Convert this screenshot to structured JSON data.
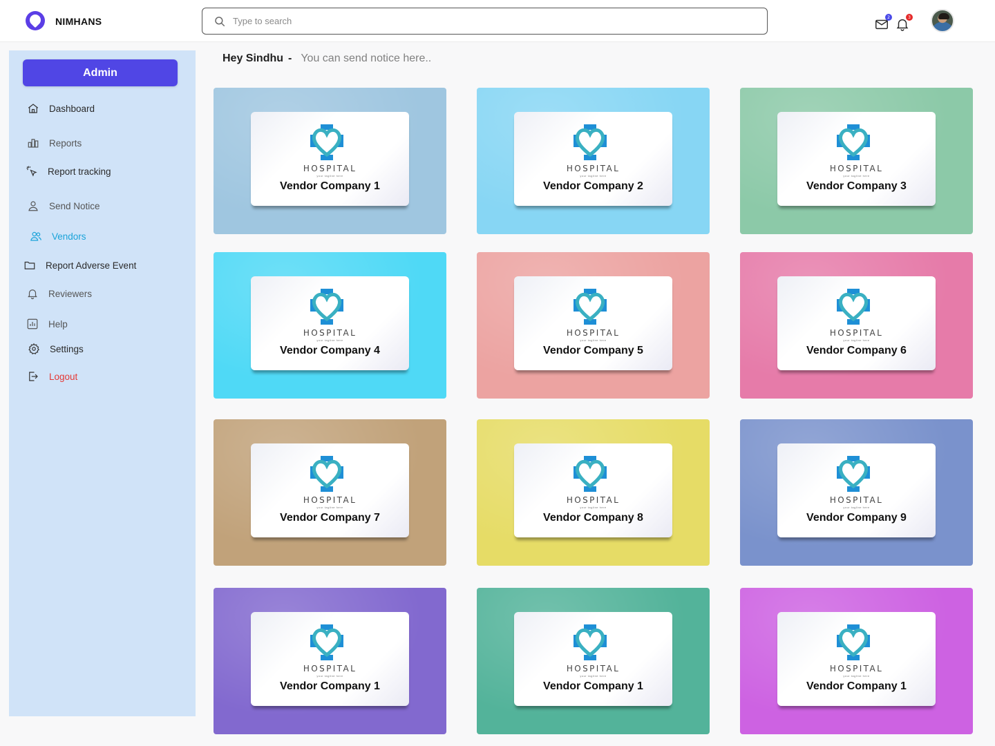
{
  "header": {
    "brand": "NIMHANS",
    "search_placeholder": "Type to search",
    "mail_badge": "2",
    "bell_badge": "3"
  },
  "sidebar": {
    "admin_label": "Admin",
    "items": [
      {
        "label": "Dashboard",
        "icon": "home-icon"
      },
      {
        "label": "Reports",
        "icon": "bar-chart-icon"
      },
      {
        "label": "Report tracking",
        "icon": "cursor-click-icon"
      },
      {
        "label": "Send Notice",
        "icon": "user-icon"
      },
      {
        "label": "Vendors",
        "icon": "users-icon",
        "active": true
      },
      {
        "label": "Report Adverse Event",
        "icon": "folder-icon"
      },
      {
        "label": "Reviewers",
        "icon": "bell-icon"
      },
      {
        "label": "Help",
        "icon": "help-chart-icon"
      },
      {
        "label": "Settings",
        "icon": "gear-icon"
      },
      {
        "label": "Logout",
        "icon": "logout-icon"
      }
    ]
  },
  "greeting": {
    "name": "Hey Sindhu",
    "dash": "-",
    "notice": "You can send notice  here.."
  },
  "vendors": [
    {
      "name": "Vendor Company 1",
      "logo_text": "HOSPITAL",
      "tagline": "your tagline here",
      "bg": "#9fc6e0"
    },
    {
      "name": "Vendor Company 2",
      "logo_text": "HOSPITAL",
      "tagline": "your tagline here",
      "bg": "#87d6f4"
    },
    {
      "name": "Vendor Company 3",
      "logo_text": "HOSPITAL",
      "tagline": "your tagline here",
      "bg": "#8cc9a8"
    },
    {
      "name": "Vendor Company 4",
      "logo_text": "HOSPITAL",
      "tagline": "your tagline here",
      "bg": "#4fd9f6"
    },
    {
      "name": "Vendor Company 5",
      "logo_text": "HOSPITAL",
      "tagline": "your tagline here",
      "bg": "#eca3a1"
    },
    {
      "name": "Vendor Company 6",
      "logo_text": "HOSPITAL",
      "tagline": "your tagline here",
      "bg": "#e67ba9"
    },
    {
      "name": "Vendor Company 7",
      "logo_text": "HOSPITAL",
      "tagline": "your tagline here",
      "bg": "#c1a27a"
    },
    {
      "name": "Vendor Company 8",
      "logo_text": "HOSPITAL",
      "tagline": "your tagline here",
      "bg": "#e6dc66"
    },
    {
      "name": "Vendor Company 9",
      "logo_text": "HOSPITAL",
      "tagline": "your tagline here",
      "bg": "#7a92cc"
    },
    {
      "name": "Vendor Company 1",
      "logo_text": "HOSPITAL",
      "tagline": "your tagline here",
      "bg": "#8269cf"
    },
    {
      "name": "Vendor Company 1",
      "logo_text": "HOSPITAL",
      "tagline": "your tagline here",
      "bg": "#53b39a"
    },
    {
      "name": "Vendor Company 1",
      "logo_text": "HOSPITAL",
      "tagline": "your tagline here",
      "bg": "#cd62e2"
    }
  ],
  "colors": {
    "accent": "#5046e5",
    "active_nav": "#1aa3d9",
    "logout": "#e53935",
    "sidebar_bg": "#d0e3f8",
    "logo_blue": "#1e8fd6",
    "logo_teal": "#3ab0c2"
  }
}
